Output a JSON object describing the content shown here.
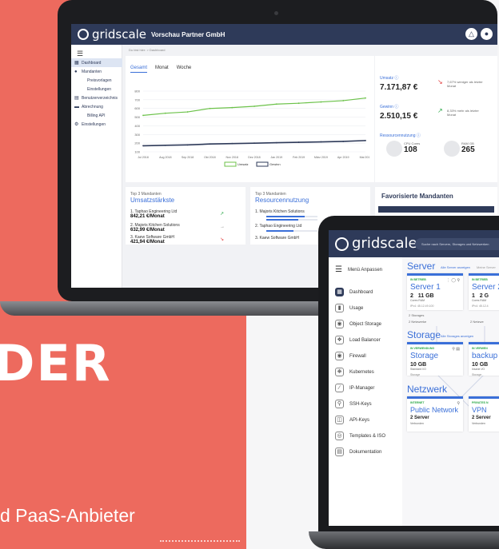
{
  "hero": {
    "headline": "DER",
    "subline": "d PaaS-Anbieter"
  },
  "dash": {
    "logo": "gridscale",
    "org": "Vorschau Partner GmbH",
    "breadcrumb": "Du bist hier: > Dashboard",
    "menu": [
      {
        "label": "Dashboard",
        "icon": "grid-icon",
        "active": true
      },
      {
        "label": "Mandanten",
        "icon": "users-icon"
      },
      {
        "label": "Preisvorlagen",
        "sub": true
      },
      {
        "label": "Einstellungen",
        "sub": true
      },
      {
        "label": "Benutzerverzeichnis",
        "icon": "book-icon"
      },
      {
        "label": "Abrechnung",
        "icon": "card-icon"
      },
      {
        "label": "Billing API",
        "sub": true
      },
      {
        "label": "Einstellungen",
        "icon": "gear-icon"
      }
    ],
    "tabs": [
      "Gesamt",
      "Monat",
      "Woche"
    ],
    "stats": {
      "umsatz_label": "Umsatz ⓘ",
      "umsatz_value": "7.171,87 €",
      "umsatz_note": "7,67% weniger als letzter Monat",
      "gewinn_label": "Gewinn ⓘ",
      "gewinn_value": "2.510,15 €",
      "gewinn_note": "8,33% mehr als letzter Monat",
      "res_label": "Ressourcennutzung ⓘ",
      "cpu_label": "CPU Cores",
      "cpu_value": "108",
      "ram_label": "RAM GB",
      "ram_value": "265"
    },
    "top_umsatz": {
      "tiny": "Top 3 Mandanten",
      "title": "Umsatzstärkste",
      "items": [
        {
          "name": "1. Taphao Engineering Ltd",
          "value": "842,21 €/Monat"
        },
        {
          "name": "2. Majoris Kitchen Solutions",
          "value": "632,99 €/Monat"
        },
        {
          "name": "3. Kaew Software GmbH",
          "value": "421,94 €/Monat"
        }
      ]
    },
    "top_res": {
      "tiny": "Top 3 Mandanten",
      "title": "Resourcennutzung",
      "items": [
        {
          "name": "1. Majoris Kitchen Solutions"
        },
        {
          "name": "2. Taphao Engineering Ltd"
        },
        {
          "name": "3. Kaew Software GmbH"
        }
      ]
    },
    "fav": {
      "title": "Favorisierte Mandanten",
      "row": "Kaew Software GmbH"
    }
  },
  "chart_data": {
    "type": "line",
    "x": [
      "Jul 2018",
      "Aug 2018",
      "Sep 2018",
      "Okt 2018",
      "Nov 2018",
      "Dez 2018",
      "Jan 2019",
      "Feb 2019",
      "März 2019",
      "Apr 2019",
      "Mai 2019"
    ],
    "series": [
      {
        "name": "Umsatz",
        "values": [
          520,
          545,
          560,
          600,
          610,
          625,
          650,
          660,
          675,
          690,
          720
        ]
      },
      {
        "name": "Gewinn",
        "values": [
          170,
          175,
          180,
          190,
          195,
          200,
          205,
          210,
          215,
          220,
          230
        ]
      }
    ],
    "yticks": [
      100,
      200,
      300,
      400,
      500,
      600,
      700,
      800
    ],
    "ylim": [
      100,
      800
    ],
    "legend": "bottom",
    "grid": true
  },
  "app": {
    "logo": "gridscale",
    "search": "Suche nach Servern, Storages und Netzwerken",
    "menu": [
      {
        "label": "Menü Anpassen",
        "icon": "menu-icon"
      },
      {
        "label": "Dashboard",
        "icon": "dashboard-icon"
      },
      {
        "label": "Usage",
        "icon": "usage-icon"
      },
      {
        "label": "Object Storage",
        "icon": "storage-icon"
      },
      {
        "label": "Load Balancer",
        "icon": "balancer-icon"
      },
      {
        "label": "Firewall",
        "icon": "firewall-icon"
      },
      {
        "label": "Kubernetes",
        "icon": "kubernetes-icon"
      },
      {
        "label": "IP-Manager",
        "icon": "ip-icon"
      },
      {
        "label": "SSH-Keys",
        "icon": "key-icon"
      },
      {
        "label": "API-Keys",
        "icon": "api-icon"
      },
      {
        "label": "Templates & ISO",
        "icon": "template-icon"
      },
      {
        "label": "Dokumentation",
        "icon": "doc-icon"
      }
    ],
    "server_title": "Server",
    "server_link": "Alle Server anzeigen",
    "server_link2": "Meine Server",
    "server1": {
      "status": "IN BETRIEB",
      "name": "Server 1",
      "cores": "2",
      "ram": "11 GB",
      "sub": "Cores    RAM",
      "ip": "IPv4: 45.12.49.100",
      "foot1": "2 Storages",
      "foot2": "2 Netzwerke"
    },
    "server2": {
      "status": "IN BETRIEB",
      "name": "Server 2",
      "cores": "1",
      "ram": "2 G",
      "sub": "Cores    RAM",
      "ip": "IPv4: 45.12.4",
      "foot2": "2 Netzwe"
    },
    "storage_title": "Storage",
    "storage_link": "Alle Storages anzeigen",
    "storage1": {
      "status": "IN VERWENDUNG",
      "name": "Storage",
      "size": "10 GB",
      "sub": "Standard I/O",
      "type": "Storage"
    },
    "storage2": {
      "status": "IN VERWEN",
      "name": "backup",
      "size": "10 GB",
      "sub": "Insane I/O",
      "type": "Storage"
    },
    "net_title": "Netzwerk",
    "net1": {
      "status": "INTERNET",
      "name": "Public Network",
      "servers": "2 Server",
      "sub": "Verbunden"
    },
    "net2": {
      "status": "PRIVATES N",
      "name": "VPN",
      "servers": "2 Server",
      "sub": "Verbunden"
    }
  },
  "colors": {
    "coral": "#ed6a5e",
    "navy": "#2e3a59",
    "accent": "#3a6fd8",
    "green": "#27a744",
    "red": "#e23c3c"
  }
}
